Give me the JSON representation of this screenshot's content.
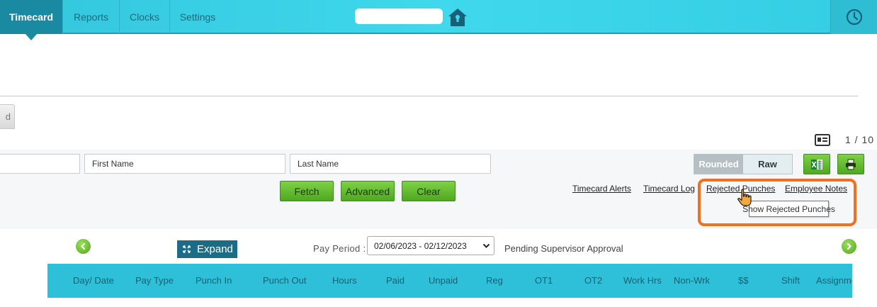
{
  "nav": {
    "tabs": [
      {
        "label": "Timecard",
        "active": true
      },
      {
        "label": "Reports"
      },
      {
        "label": "Clocks"
      },
      {
        "label": "Settings"
      }
    ],
    "home_icon": "home-icon",
    "clock_icon": "clock-icon"
  },
  "page": {
    "partial_tab_label": "d",
    "pager": "1 / 10"
  },
  "filters": {
    "first_name_placeholder": "First Name",
    "last_name_placeholder": "Last Name",
    "fetch_label": "Fetch",
    "advanced_label": "Advanced",
    "clear_label": "Clear",
    "toggle": {
      "rounded": "Rounded",
      "raw": "Raw",
      "selected": "Rounded"
    },
    "links": {
      "timecard_alerts": "Timecard Alerts",
      "timecard_log": "Timecard Log",
      "rejected_punches": "Rejected Punches",
      "employee_notes": "Employee Notes"
    },
    "tooltip": "Show Rejected Punches"
  },
  "period": {
    "expand_label": "Expand",
    "pay_period_label": "Pay Period :",
    "pay_period_value": "02/06/2023 - 02/12/2023",
    "status": "Pending Supervisor Approval"
  },
  "table": {
    "columns": [
      "Day/ Date",
      "Pay Type",
      "Punch In",
      "Punch Out",
      "Hours",
      "Paid",
      "Unpaid",
      "Reg",
      "OT1",
      "OT2",
      "Work Hrs",
      "Non-Wrk",
      "$$",
      "Shift",
      "Assignment"
    ]
  },
  "colors": {
    "nav_bg": "#3fd8ec",
    "active_tab": "#1a8aa3",
    "button_green": "#5cb82c",
    "highlight_orange": "#f07020",
    "table_header": "#2ec0d8"
  }
}
